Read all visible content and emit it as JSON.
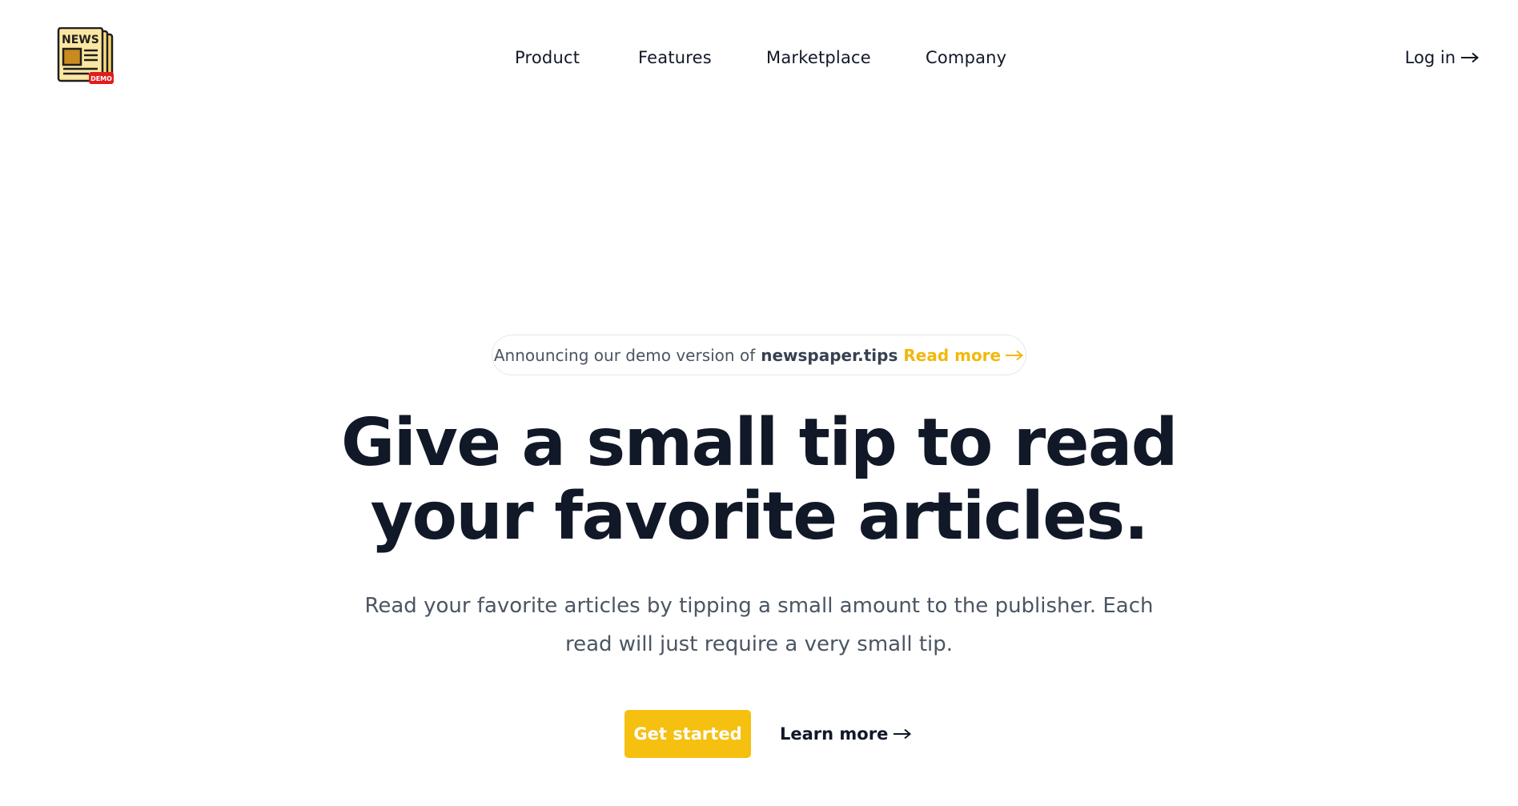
{
  "header": {
    "logo_text": "NEWS",
    "logo_badge": "DEMO",
    "nav": [
      {
        "label": "Product"
      },
      {
        "label": "Features"
      },
      {
        "label": "Marketplace"
      },
      {
        "label": "Company"
      }
    ],
    "login_label": "Log in"
  },
  "announcement": {
    "prefix": "Announcing our demo version of",
    "brand": "newspaper.tips",
    "link_label": "Read more"
  },
  "hero": {
    "title_line1": "Give a small tip to read",
    "title_line2": "your favorite articles.",
    "subtitle": "Read your favorite articles by tipping a small amount to the publisher. Each read will just require a very small tip."
  },
  "cta": {
    "primary_label": "Get started",
    "secondary_label": "Learn more"
  },
  "colors": {
    "accent": "#f5c010",
    "accent_text": "#f0b90b",
    "heading": "#111827",
    "body_text": "#4b5563",
    "badge_red": "#e11d1d"
  },
  "icons": {
    "logo": "newspaper-icon",
    "arrow": "arrow-right-icon"
  }
}
